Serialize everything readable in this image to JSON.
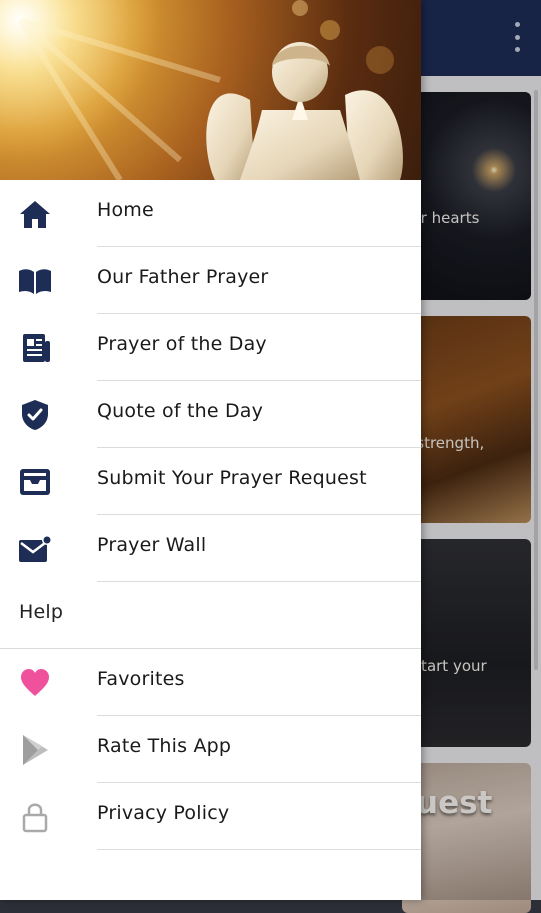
{
  "background": {
    "cards": [
      {
        "text": "our hearts"
      },
      {
        "text": "h strength,"
      },
      {
        "text": ". Start your"
      },
      {
        "text": "uest"
      }
    ]
  },
  "drawer": {
    "items": [
      {
        "label": "Home",
        "icon": "home-icon"
      },
      {
        "label": "Our Father Prayer",
        "icon": "book-icon"
      },
      {
        "label": "Prayer of the Day",
        "icon": "newspaper-icon"
      },
      {
        "label": "Quote of the Day",
        "icon": "shield-check-icon"
      },
      {
        "label": "Submit Your Prayer Request",
        "icon": "inbox-icon"
      },
      {
        "label": "Prayer Wall",
        "icon": "mail-notification-icon"
      }
    ],
    "section_header": "Help",
    "help_items": [
      {
        "label": "Favorites",
        "icon": "heart-icon"
      },
      {
        "label": "Rate This App",
        "icon": "play-store-icon"
      },
      {
        "label": "Privacy Policy",
        "icon": "lock-icon"
      }
    ]
  },
  "colors": {
    "primary": "#1e2d55",
    "icon_navy": "#1e2d55",
    "heart_pink": "#f0519c",
    "icon_gray": "#a9a9a9"
  }
}
